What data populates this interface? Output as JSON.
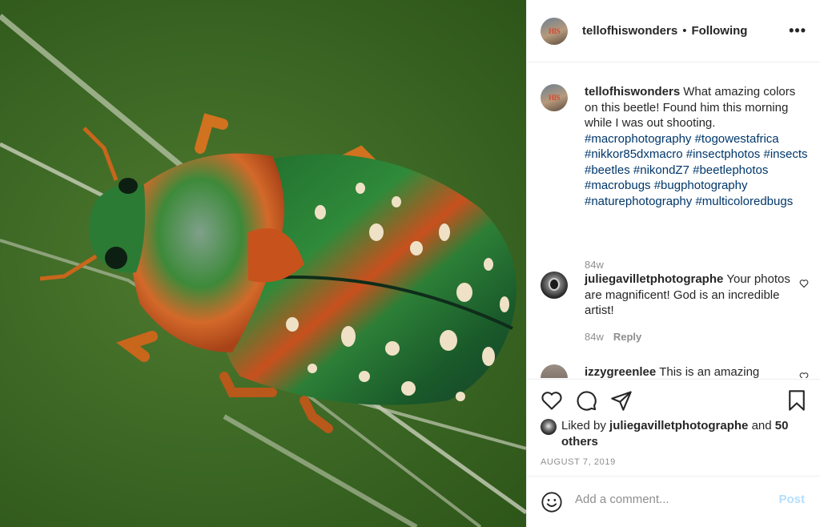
{
  "post": {
    "image": {
      "subject": "beetle-photo"
    },
    "header": {
      "username": "tellofhiswonders",
      "separator": "•",
      "follow_status": "Following",
      "more_label": "•••",
      "avatar_text": "HIS"
    },
    "caption": {
      "username": "tellofhiswonders",
      "text": "What amazing colors on this beetle! Found him this morning while I was out shooting.",
      "hashtags": [
        "#macrophotography",
        "#togowestafrica",
        "#nikkor85dxmacro",
        "#insectphotos",
        "#insects",
        "#beetles",
        "#nikondZ7",
        "#beetlephotos",
        "#macrobugs",
        "#bugphotography",
        "#naturephotography",
        "#multicoloredbugs"
      ],
      "time": "84w"
    },
    "comments": [
      {
        "username": "juliegavilletphotographe",
        "text": "Your photos are magnificent! God is an incredible artist!",
        "time": "84w",
        "reply_label": "Reply"
      },
      {
        "username": "izzygreenlee",
        "text": "This is an amazing"
      }
    ],
    "likes": {
      "prefix": "Liked by",
      "username": "juliegavilletphotographe",
      "connector": "and",
      "others": "50 others"
    },
    "date": "AUGUST 7, 2019",
    "add_comment": {
      "placeholder": "Add a comment...",
      "post_label": "Post"
    },
    "icons": {
      "like": "heart-icon",
      "comment": "comment-icon",
      "share": "paper-plane-icon",
      "save": "bookmark-icon",
      "emoji": "smiley-icon",
      "more": "ellipsis-icon",
      "comment_like": "small-heart-icon"
    },
    "colors": {
      "link": "#00376b",
      "secondary": "#8e8e8e",
      "post_disabled": "#b2dffc"
    }
  }
}
